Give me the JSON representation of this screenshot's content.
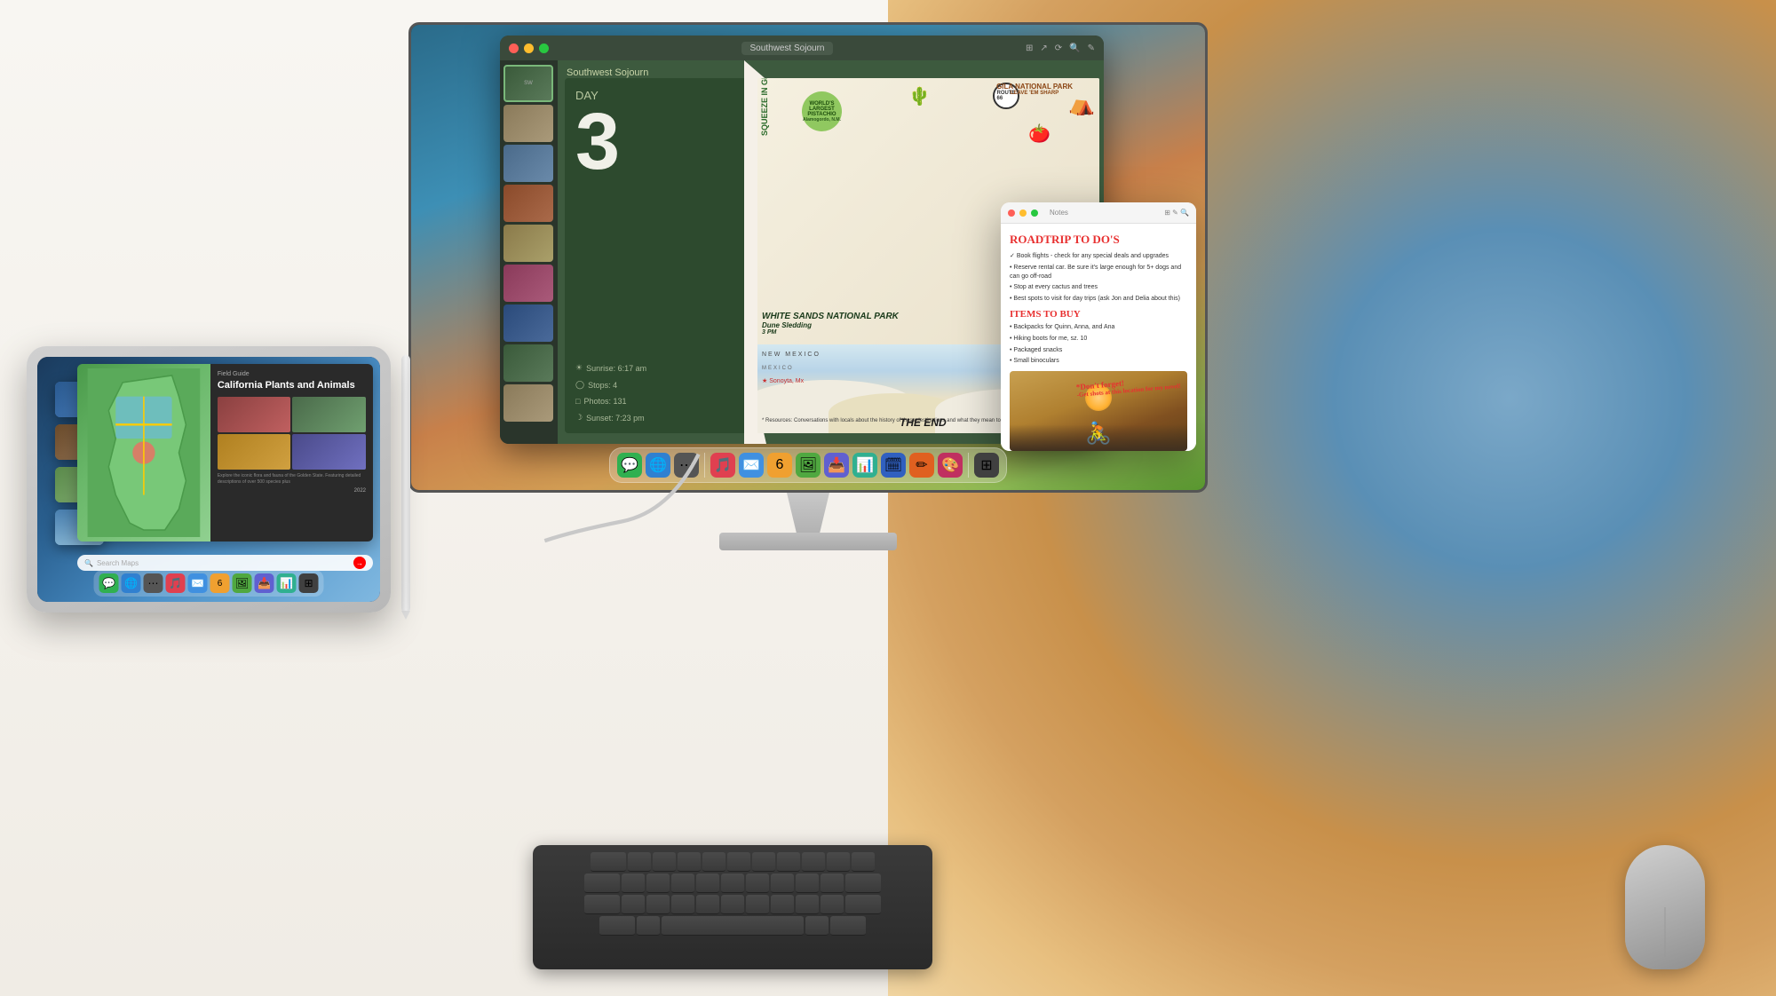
{
  "scene": {
    "title": "Apple iPad and Mac display setup",
    "description": "iPad connected to external Studio Display showing Freeform and Notes apps"
  },
  "monitor": {
    "app_title": "Southwest Sojourn",
    "tab_label": "Southwest Sojourn",
    "day_label": "Southwest Sojourn",
    "day_sub": "DAY",
    "day_number": "3",
    "stats": [
      {
        "icon": "☀",
        "label": "Sunrise: 6:17 am"
      },
      {
        "icon": "◯",
        "label": "Stops: 4"
      },
      {
        "icon": "□",
        "label": "Photos: 131"
      },
      {
        "icon": "☾",
        "label": "Sunset: 7:23 pm"
      }
    ],
    "collage_labels": {
      "worlds_largest": "WORLD'S LARGEST PISTACHIO",
      "pistachio_location": "Alamogordo, N.M.",
      "route": "ROUTE 66",
      "squeeze": "SQUEEZE IN GREEN",
      "gila": "GILA NATIONAL PARK",
      "gila_sub": "LEAVE 'EM SHARP",
      "white_sands": "WHITE SANDS NATIONAL PARK",
      "white_sands_sub": "Dune Sledding",
      "white_sands_detail": "3 PM",
      "new_mexico": "NEW MEXICO",
      "mexico": "MEXICO",
      "location": "Sonoyta, Mx",
      "resources": "* Resources: Conversations with locals about the history of these destinations and what they mean to them",
      "the_end": "THE END"
    },
    "notes": {
      "title": "ROADTRIP TO DO'S",
      "items": [
        "Book flights - check for any special deals and upgrades",
        "Reserve rental car. Be sure it's large enough for 5+ dogs and can go off-road",
        "Stop at every cactus and trees",
        "Best spots to visit for day trips (ask Jon and Delia about this)"
      ],
      "subtitle": "ITEMS TO BUY",
      "buy_items": [
        "Backpacks for Quinn, Anna, and Ana",
        "Hiking boots for me, sz. 10",
        "Packaged snacks",
        "Small binoculars"
      ],
      "dont_forget": "*Don't forget!",
      "dont_forget_sub": "-Get shots at this location for my novel!"
    }
  },
  "dock": {
    "icons": [
      "💬",
      "🌐",
      "⋯",
      "🎵",
      "✉️",
      "6",
      "🖼",
      "📥",
      "📊",
      "🗓",
      "✏",
      "🎨",
      "⊞"
    ]
  },
  "ipad": {
    "app_title": "Field Guide",
    "book_title": "California Plants and Animals",
    "book_description": "Explore the iconic flora and fauna of the Golden State. Featuring detailed descriptions of over 500 species plus",
    "year": "2022",
    "search_placeholder": "Search Maps",
    "dock_icons": [
      "💬",
      "🌐",
      "⋯",
      "🎵",
      "✉️",
      "6",
      "🖼",
      "📥",
      "📊",
      "⊞"
    ]
  },
  "keyboard": {
    "label": "Magic Keyboard"
  },
  "mouse": {
    "label": "Magic Mouse"
  }
}
